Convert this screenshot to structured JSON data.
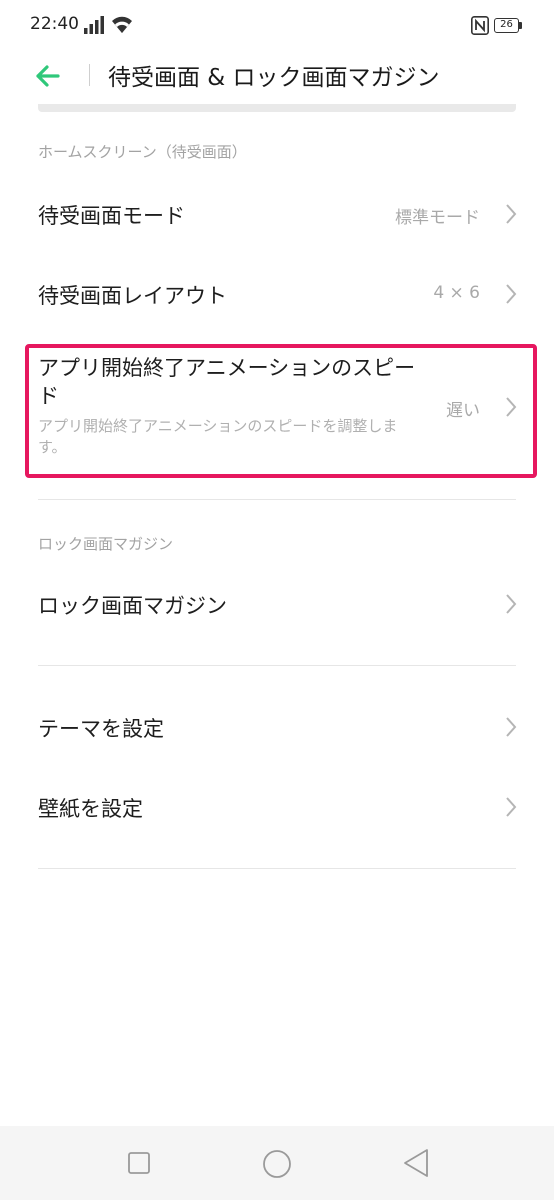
{
  "status_bar": {
    "time": "22:40",
    "battery_level": "26",
    "icons": [
      "signal-icon",
      "wifi-icon",
      "nfc-icon",
      "battery-icon"
    ]
  },
  "header": {
    "title": "待受画面 & ロック画面マガジン",
    "back_icon": "arrow-left-icon",
    "accent_color": "#2fc87a"
  },
  "sections": {
    "home": {
      "header": "ホームスクリーン（待受画面）",
      "items": [
        {
          "title": "待受画面モード",
          "value": "標準モード"
        },
        {
          "title": "待受画面レイアウト",
          "value": "4 × 6"
        },
        {
          "title": "アプリ開始終了アニメーションのスピード",
          "value": "遅い",
          "description": "アプリ開始終了アニメーションのスピードを調整します。"
        }
      ]
    },
    "lock": {
      "header": "ロック画面マガジン",
      "items": [
        {
          "title": "ロック画面マガジン"
        }
      ]
    },
    "theme": {
      "items": [
        {
          "title": "テーマを設定"
        },
        {
          "title": "壁紙を設定"
        }
      ]
    }
  },
  "highlight_color": "#e6175f",
  "nav_bar": {
    "icons": [
      "recents-square-icon",
      "home-circle-icon",
      "back-triangle-icon"
    ]
  }
}
